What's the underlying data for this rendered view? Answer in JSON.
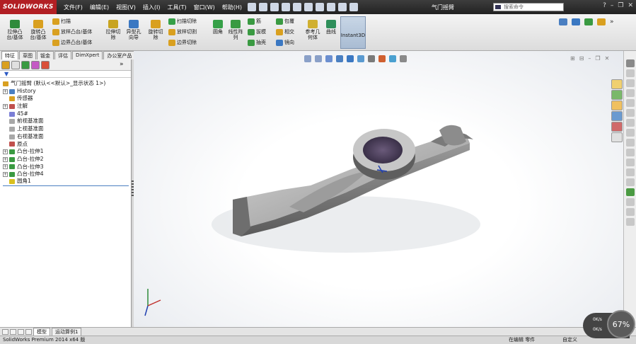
{
  "app": {
    "logo": "SOLIDWORKS",
    "title": "气门摇臂",
    "search_placeholder": "搜索命令"
  },
  "menu": [
    "文件(F)",
    "编辑(E)",
    "视图(V)",
    "插入(I)",
    "工具(T)",
    "窗口(W)",
    "帮助(H)"
  ],
  "ribbon": {
    "big": [
      {
        "label": "拉伸凸\n台/基体",
        "icon": "extrude-boss-icon",
        "color": "#2e8b3a"
      },
      {
        "label": "旋转凸\n台/基体",
        "icon": "revolve-boss-icon",
        "color": "#d9a020"
      },
      {
        "label": "拉伸切\n除",
        "icon": "extrude-cut-icon",
        "color": "#c8a420"
      },
      {
        "label": "异型孔\n向导",
        "icon": "hole-wizard-icon",
        "color": "#3b78c2"
      },
      {
        "label": "旋转切\n除",
        "icon": "revolve-cut-icon",
        "color": "#d9a020"
      },
      {
        "label": "圆角",
        "icon": "fillet-icon",
        "color": "#36a048"
      },
      {
        "label": "线性阵\n列",
        "icon": "linear-pattern-icon",
        "color": "#3a9a42"
      },
      {
        "label": "参考几\n何体",
        "icon": "reference-geometry-icon",
        "color": "#d0b030"
      },
      {
        "label": "曲线",
        "icon": "curves-icon",
        "color": "#2f8f5a"
      }
    ],
    "small": [
      "扫描",
      "放样凸台/基体",
      "边界凸台/基体",
      "扫描切除",
      "放样切割",
      "边界切除",
      "筋",
      "拔模",
      "抽壳",
      "包覆",
      "相交",
      "镜向"
    ],
    "instant3d": "Instant3D"
  },
  "tabs": [
    "特征",
    "草图",
    "钣金",
    "评估",
    "DimXpert",
    "办公室产品"
  ],
  "tree": [
    {
      "label": "气门摇臂 (默认<<默认>_显示状态 1>)",
      "expand": "",
      "color": "#d9a020"
    },
    {
      "label": "History",
      "expand": "+",
      "color": "#4a7fc1"
    },
    {
      "label": "传感器",
      "expand": "",
      "color": "#d9a020"
    },
    {
      "label": "注解",
      "expand": "+",
      "color": "#c0504d"
    },
    {
      "label": "45#",
      "expand": "",
      "color": "#7b7fd6"
    },
    {
      "label": "前视基准面",
      "expand": "",
      "color": "#8a8a8a"
    },
    {
      "label": "上视基准面",
      "expand": "",
      "color": "#8a8a8a"
    },
    {
      "label": "右视基准面",
      "expand": "",
      "color": "#8a8a8a"
    },
    {
      "label": "原点",
      "expand": "",
      "color": "#c0504d"
    },
    {
      "label": "凸台-拉伸1",
      "expand": "+",
      "color": "#3a9a42"
    },
    {
      "label": "凸台-拉伸2",
      "expand": "+",
      "color": "#3a9a42"
    },
    {
      "label": "凸台-拉伸3",
      "expand": "+",
      "color": "#3a9a42"
    },
    {
      "label": "凸台-拉伸4",
      "expand": "+",
      "color": "#3a9a42"
    },
    {
      "label": "圆角1",
      "expand": "",
      "color": "#d9c020"
    }
  ],
  "bottom_tabs": [
    "模型",
    "运动算例1"
  ],
  "status": {
    "left": "SolidWorks Premium 2014 x64 版",
    "middle": "在编辑 零件",
    "right": "自定义"
  },
  "gauge": {
    "percent": "67%",
    "up": "0K/s",
    "down": "0K/s"
  }
}
